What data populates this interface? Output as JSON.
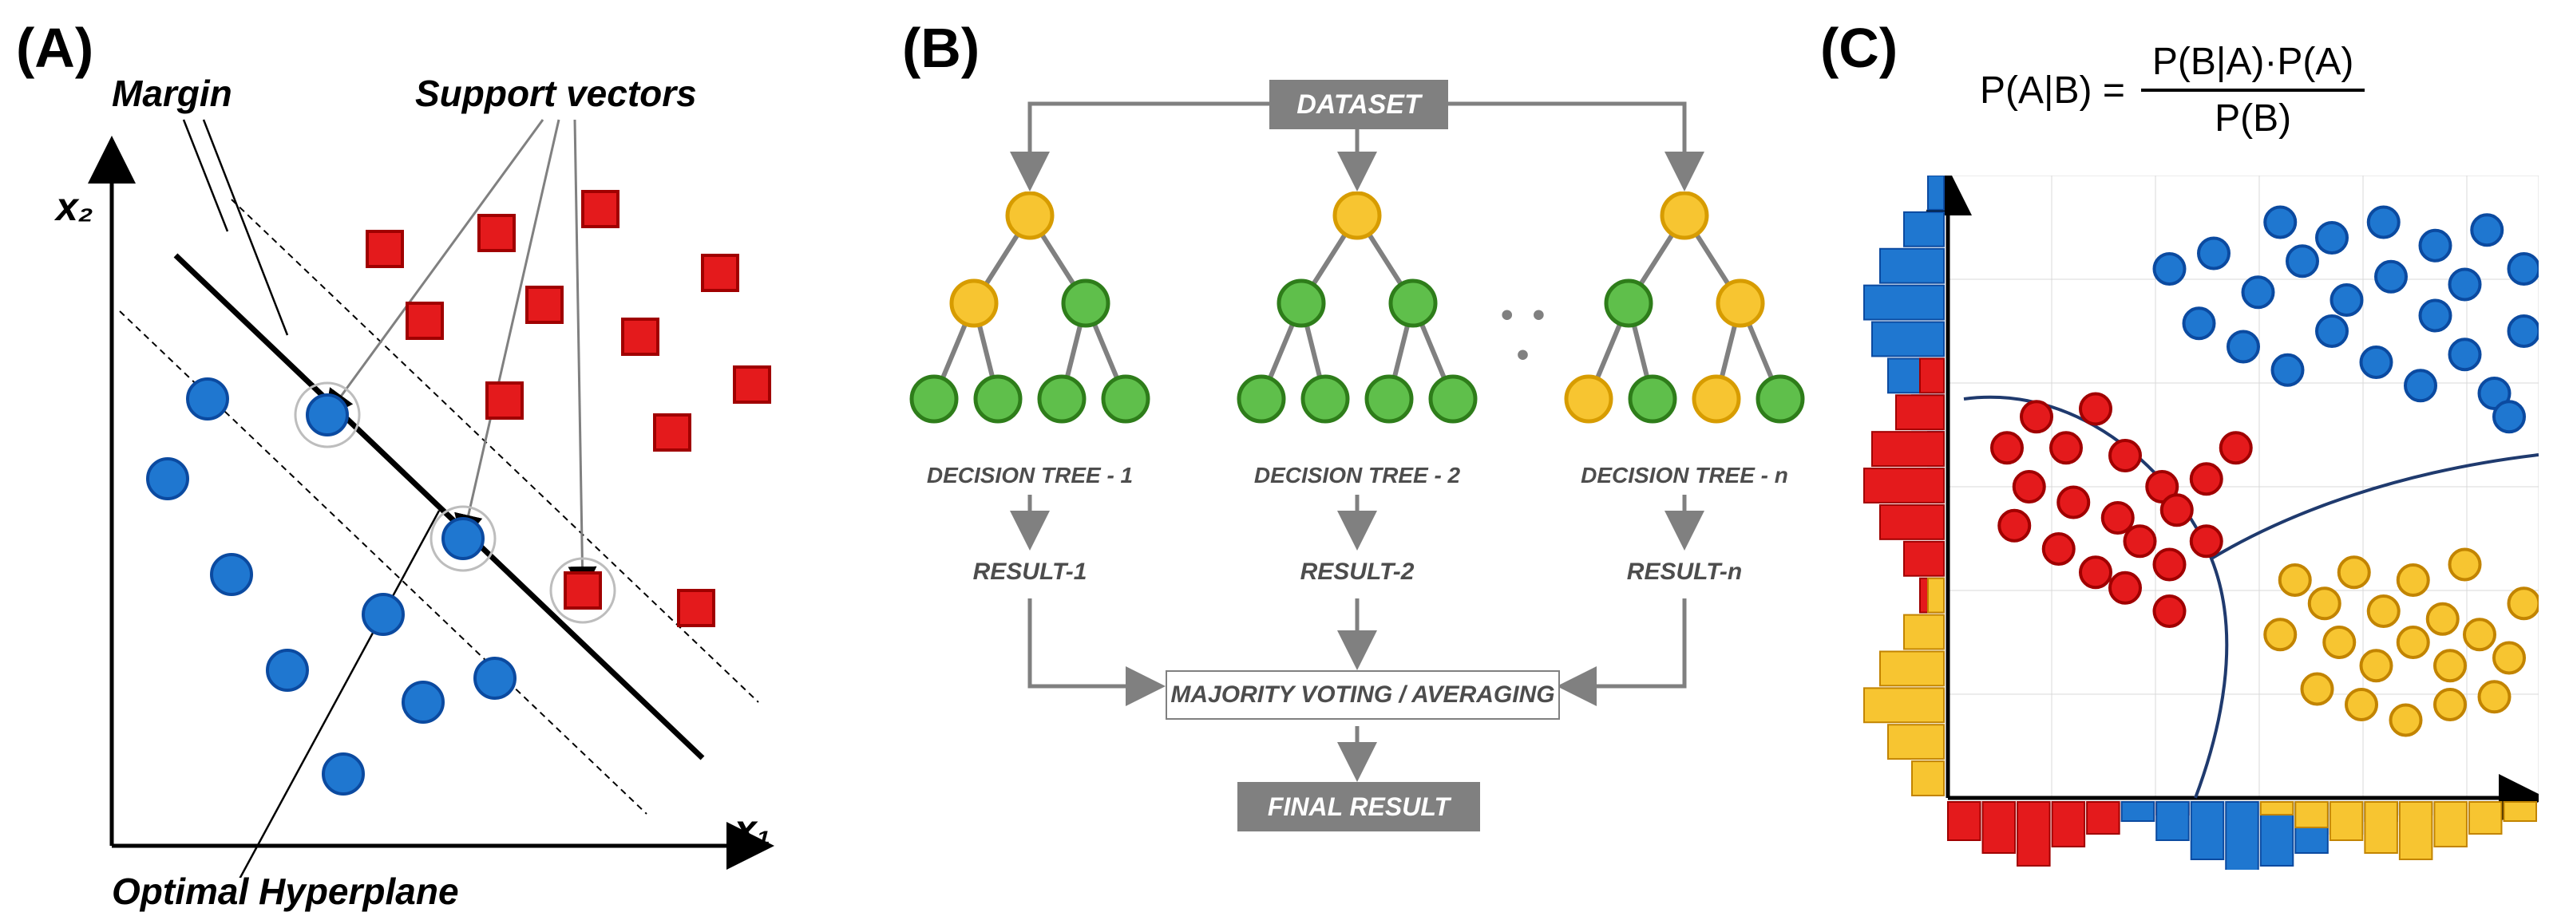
{
  "panelA": {
    "label": "(A)",
    "margin_label": "Margin",
    "support_vectors_label": "Support vectors",
    "axis_x_label": "x₁",
    "axis_y_label": "x₂",
    "hyperplane_label": "Optimal Hyperplane",
    "colors": {
      "blue": "#1f77d0",
      "blue_stroke": "#0b4aa0",
      "red": "#e41a1c",
      "red_stroke": "#a00000"
    },
    "blue_points": [
      [
        120,
        510
      ],
      [
        210,
        630
      ],
      [
        280,
        750
      ],
      [
        350,
        870
      ],
      [
        450,
        760
      ],
      [
        170,
        430
      ],
      [
        360,
        520
      ],
      [
        450,
        630
      ],
      [
        560,
        730
      ],
      [
        530,
        560
      ]
    ],
    "red_points": [
      [
        420,
        230
      ],
      [
        470,
        310
      ],
      [
        560,
        200
      ],
      [
        620,
        280
      ],
      [
        570,
        400
      ],
      [
        680,
        180
      ],
      [
        720,
        320
      ],
      [
        760,
        440
      ],
      [
        820,
        240
      ],
      [
        870,
        360
      ],
      [
        670,
        630
      ],
      [
        800,
        650
      ]
    ],
    "support_vector_indices_blue": [
      9,
      7
    ],
    "support_vector_indices_red": [
      10
    ]
  },
  "panelB": {
    "label": "(B)",
    "dataset": "DATASET",
    "majority": "MAJORITY VOTING / AVERAGING",
    "final": "FINAL RESULT",
    "tree_labels": [
      "DECISION TREE - 1",
      "DECISION TREE - 2",
      "DECISION TREE - n"
    ],
    "result_labels": [
      "RESULT-1",
      "RESULT-2",
      "RESULT-n"
    ],
    "ellipsis": "• • •",
    "colors": {
      "yellow": "#f7c531",
      "yellow_stroke": "#d79c00",
      "green": "#5fbf4b",
      "green_stroke": "#2e7d1a",
      "grey": "#808080"
    },
    "trees": [
      {
        "leaves": [
          "g",
          "g",
          "g",
          "g"
        ],
        "mid": [
          "y",
          "g"
        ]
      },
      {
        "leaves": [
          "g",
          "g",
          "g",
          "g"
        ],
        "mid": [
          "g",
          "g"
        ]
      },
      {
        "leaves": [
          "y",
          "g",
          "y",
          "g"
        ],
        "mid": [
          "g",
          "y"
        ]
      }
    ]
  },
  "panelC": {
    "label": "(C)",
    "formula_left": "P(A|B) =",
    "formula_top": "P(B|A)·P(A)",
    "formula_bottom": "P(B)",
    "colors": {
      "blue": "#1f77d0",
      "blue_s": "#0b4aa0",
      "red": "#e41a1c",
      "red_s": "#a00000",
      "yellow": "#f7c531",
      "yellow_s": "#c28400"
    },
    "chart_data": {
      "type": "scatter",
      "points": {
        "blue": [
          [
            300,
            120
          ],
          [
            360,
            100
          ],
          [
            420,
            150
          ],
          [
            480,
            110
          ],
          [
            540,
            160
          ],
          [
            600,
            130
          ],
          [
            660,
            180
          ],
          [
            700,
            140
          ],
          [
            340,
            190
          ],
          [
            400,
            220
          ],
          [
            460,
            250
          ],
          [
            520,
            200
          ],
          [
            580,
            240
          ],
          [
            640,
            270
          ],
          [
            700,
            230
          ],
          [
            740,
            280
          ],
          [
            450,
            60
          ],
          [
            520,
            80
          ],
          [
            590,
            60
          ],
          [
            660,
            90
          ],
          [
            730,
            70
          ],
          [
            780,
            120
          ],
          [
            780,
            200
          ],
          [
            760,
            310
          ]
        ],
        "red": [
          [
            120,
            310
          ],
          [
            160,
            350
          ],
          [
            200,
            300
          ],
          [
            240,
            360
          ],
          [
            110,
            400
          ],
          [
            170,
            420
          ],
          [
            230,
            440
          ],
          [
            290,
            400
          ],
          [
            150,
            480
          ],
          [
            200,
            510
          ],
          [
            260,
            470
          ],
          [
            310,
            430
          ],
          [
            350,
            390
          ],
          [
            390,
            350
          ],
          [
            300,
            500
          ],
          [
            350,
            470
          ],
          [
            240,
            530
          ],
          [
            300,
            560
          ],
          [
            80,
            350
          ],
          [
            90,
            450
          ]
        ],
        "yellow": [
          [
            470,
            520
          ],
          [
            510,
            550
          ],
          [
            550,
            510
          ],
          [
            590,
            560
          ],
          [
            630,
            520
          ],
          [
            670,
            570
          ],
          [
            530,
            600
          ],
          [
            580,
            630
          ],
          [
            630,
            600
          ],
          [
            680,
            630
          ],
          [
            720,
            590
          ],
          [
            760,
            620
          ],
          [
            500,
            660
          ],
          [
            560,
            680
          ],
          [
            620,
            700
          ],
          [
            680,
            680
          ],
          [
            740,
            670
          ],
          [
            450,
            590
          ],
          [
            780,
            550
          ],
          [
            700,
            500
          ]
        ]
      },
      "x_hist": {
        "bins": 17,
        "series": [
          {
            "color": "red",
            "values": [
              6,
              8,
              10,
              7,
              5,
              3,
              2,
              0,
              0,
              0,
              0,
              0,
              0,
              0,
              0,
              0,
              0
            ]
          },
          {
            "color": "blue",
            "values": [
              0,
              0,
              0,
              0,
              0,
              3,
              6,
              9,
              11,
              10,
              8,
              5,
              3,
              2,
              0,
              0,
              0
            ]
          },
          {
            "color": "yellow",
            "values": [
              0,
              0,
              0,
              0,
              0,
              0,
              0,
              0,
              0,
              2,
              4,
              6,
              8,
              9,
              7,
              5,
              3
            ]
          }
        ]
      },
      "y_hist": {
        "bins": 17,
        "series": [
          {
            "color": "blue",
            "values": [
              2,
              5,
              8,
              10,
              9,
              7,
              4,
              2,
              0,
              0,
              0,
              0,
              0,
              0,
              0,
              0,
              0
            ]
          },
          {
            "color": "red",
            "values": [
              0,
              0,
              0,
              0,
              0,
              3,
              6,
              9,
              10,
              8,
              5,
              3,
              0,
              0,
              0,
              0,
              0
            ]
          },
          {
            "color": "yellow",
            "values": [
              0,
              0,
              0,
              0,
              0,
              0,
              0,
              0,
              0,
              0,
              0,
              2,
              5,
              8,
              10,
              7,
              4
            ]
          }
        ]
      },
      "boundary_note": "two curved decision boundaries separating three gaussian clusters"
    }
  }
}
